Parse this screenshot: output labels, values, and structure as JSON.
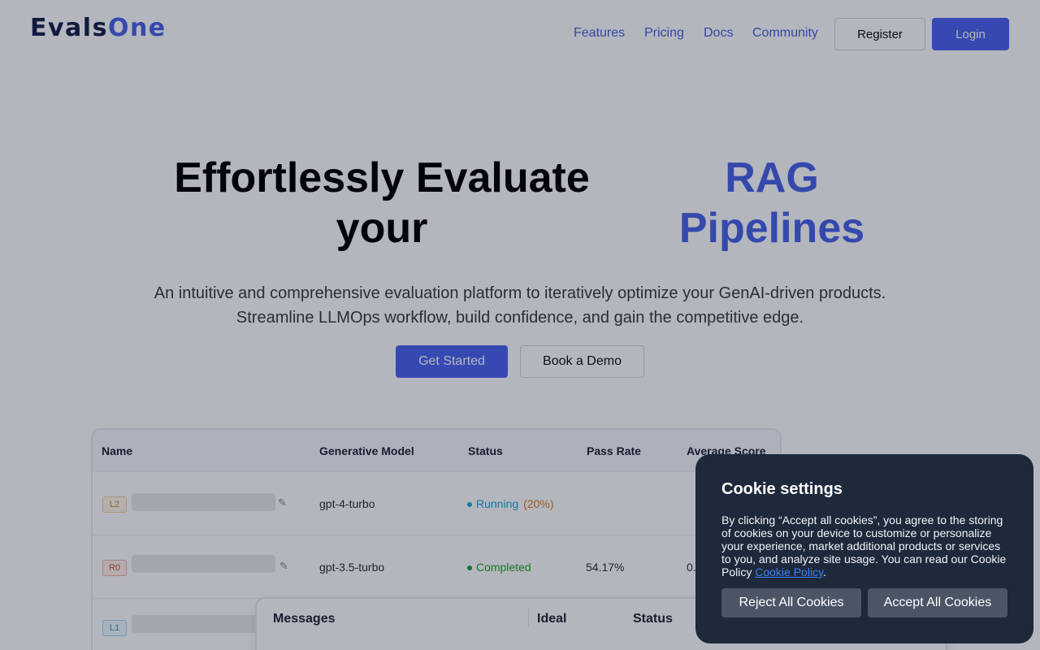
{
  "brand": {
    "logo_part1": "Evals",
    "logo_part2": "O",
    "logo_part3": "ne"
  },
  "nav": {
    "links": [
      "Features",
      "Pricing",
      "Docs",
      "Community"
    ],
    "register": "Register",
    "login": "Login"
  },
  "hero": {
    "title_left_line1": "Effortlessly Evaluate",
    "title_left_line2": "your",
    "title_right_line1": "RAG",
    "title_right_line2": "Pipelines",
    "subtitle_line1": "An intuitive and comprehensive evaluation platform to iteratively optimize your GenAI-driven products.",
    "subtitle_line2": "Streamline LLMOps workflow, build confidence, and gain the competitive edge.",
    "cta_primary": "Get Started",
    "cta_secondary": "Book a Demo"
  },
  "table": {
    "headers": [
      "Name",
      "Generative Model",
      "Status",
      "Pass Rate",
      "Average Score"
    ],
    "rows": [
      {
        "tag": "L2",
        "model": "gpt-4-turbo",
        "status": "Running",
        "progress": "(20%)",
        "pass_rate": "",
        "avg_score": ""
      },
      {
        "tag": "R0",
        "model": "gpt-3.5-turbo",
        "status": "Completed",
        "progress": "",
        "pass_rate": "54.17%",
        "avg_score": "0."
      },
      {
        "tag": "L1",
        "model": "",
        "status": "",
        "progress": "",
        "pass_rate": "",
        "avg_score": ""
      }
    ]
  },
  "messages_panel": {
    "headers": [
      "Messages",
      "Ideal",
      "Status"
    ]
  },
  "cookie": {
    "title": "Cookie settings",
    "body": "By clicking “Accept all cookies”, you agree to the storing of cookies on your device to customize or personalize your experience, market additional products or services to you, and analyze site usage. You can read our Cookie Policy ",
    "link": "Cookie Policy",
    "period": ".",
    "reject": "Reject All Cookies",
    "accept": "Accept All Cookies"
  },
  "colors": {
    "accent": "#4b63ee",
    "cookie_bg": "#1e293b",
    "running": "#1aa6d8",
    "completed": "#21a521"
  }
}
